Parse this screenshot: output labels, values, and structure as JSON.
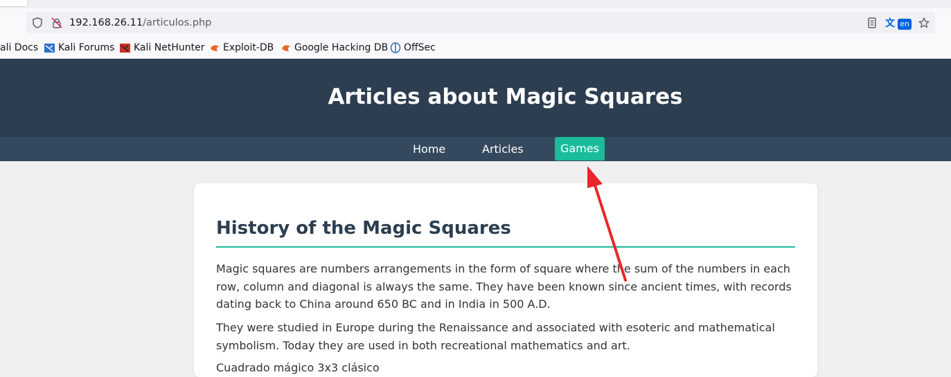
{
  "browser": {
    "url_host": "192.168.26.11",
    "url_path": "/articulos.php",
    "bookmarks": [
      {
        "label": "ali Docs",
        "icon": "kali-docs-icon"
      },
      {
        "label": "Kali Forums",
        "icon": "kali-forums-icon"
      },
      {
        "label": "Kali NetHunter",
        "icon": "kali-nethunter-icon"
      },
      {
        "label": "Exploit-DB",
        "icon": "exploit-db-icon"
      },
      {
        "label": "Google Hacking DB",
        "icon": "ghdb-icon"
      },
      {
        "label": "OffSec",
        "icon": "offsec-icon"
      }
    ],
    "translate_badge": "en"
  },
  "site": {
    "title": "Articles about Magic Squares",
    "nav": [
      {
        "label": "Home",
        "active": false
      },
      {
        "label": "Articles",
        "active": false
      },
      {
        "label": "Games",
        "active": true
      }
    ]
  },
  "article": {
    "heading": "History of the Magic Squares",
    "paragraphs": [
      "Magic squares are numbers arrangements in the form of square where the sum of the numbers in each row, column and diagonal is always the same. They have been known since ancient times, with records dating back to China around 650 BC and in India in 500 A.D.",
      "They were studied in Europe during the Renaissance and associated with esoteric and mathematical symbolism. Today they are used in both recreational mathematics and art.",
      "Cuadrado mágico 3x3 clásico"
    ]
  },
  "colors": {
    "header_bg": "#2c3e50",
    "nav_bg": "#34495e",
    "accent": "#1abc9c",
    "annotation_arrow": "#e8262b"
  }
}
